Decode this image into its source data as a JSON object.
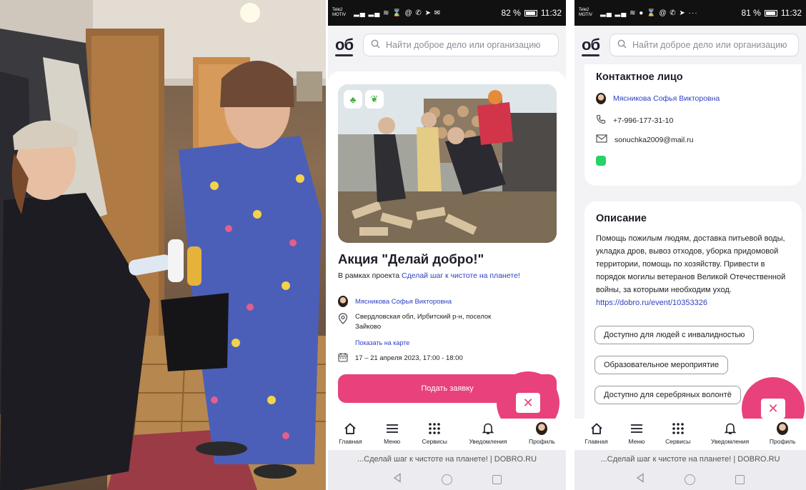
{
  "status_left": {
    "carrier": "Tele2 MOTIV",
    "battery": "82 %",
    "time": "11:32"
  },
  "status_right": {
    "carrier": "Tele2 MOTIV",
    "battery": "81 %",
    "time": "11:32"
  },
  "logo": "об",
  "search": {
    "placeholder": "Найти доброе дело или организацию"
  },
  "event": {
    "title": "Акция \"Делай добро!\"",
    "subtitle_prefix": "В рамках проекта ",
    "project_link": "Сделай шаг к чистоте на планете!",
    "organizer": "Мясникова Софья Викторовна",
    "address_line1": "Свердловская обл, Ирбитский р-н, поселок",
    "address_line2": "Зайково",
    "map_link": "Показать на карте",
    "dates": "17 – 21 апреля 2023, 17:00 - 18:00",
    "apply_label": "Подать заявку"
  },
  "contact": {
    "title": "Контактное лицо",
    "name": "Мясникова Софья Викторовна",
    "phone": "+7-996-177-31-10",
    "email": "sonuchka2009@mail.ru"
  },
  "description": {
    "title": "Описание",
    "text": "Помощь пожилым людям, доставка питьевой воды, укладка дров, вывоз отходов, уборка придомовой территории, помощь по хозяйству. Привести в порядок могилы ветеранов Великой Отечественной войны, за которыми необходим уход. ",
    "link": "https://dobro.ru/event/10353326",
    "chips": [
      "Доступно для людей с инвалидностью",
      "Образовательное мероприятие",
      "Доступно для серебряных волонтё"
    ]
  },
  "nav": {
    "home": "Главная",
    "menu": "Меню",
    "services": "Сервисы",
    "notifications": "Уведомления",
    "profile": "Профиль"
  },
  "tab_title": "...Сделай шаг к чистоте на планете! | DOBRO.RU",
  "colors": {
    "accent": "#e8417b",
    "link": "#2d3fc2",
    "text": "#1d1d2a"
  }
}
